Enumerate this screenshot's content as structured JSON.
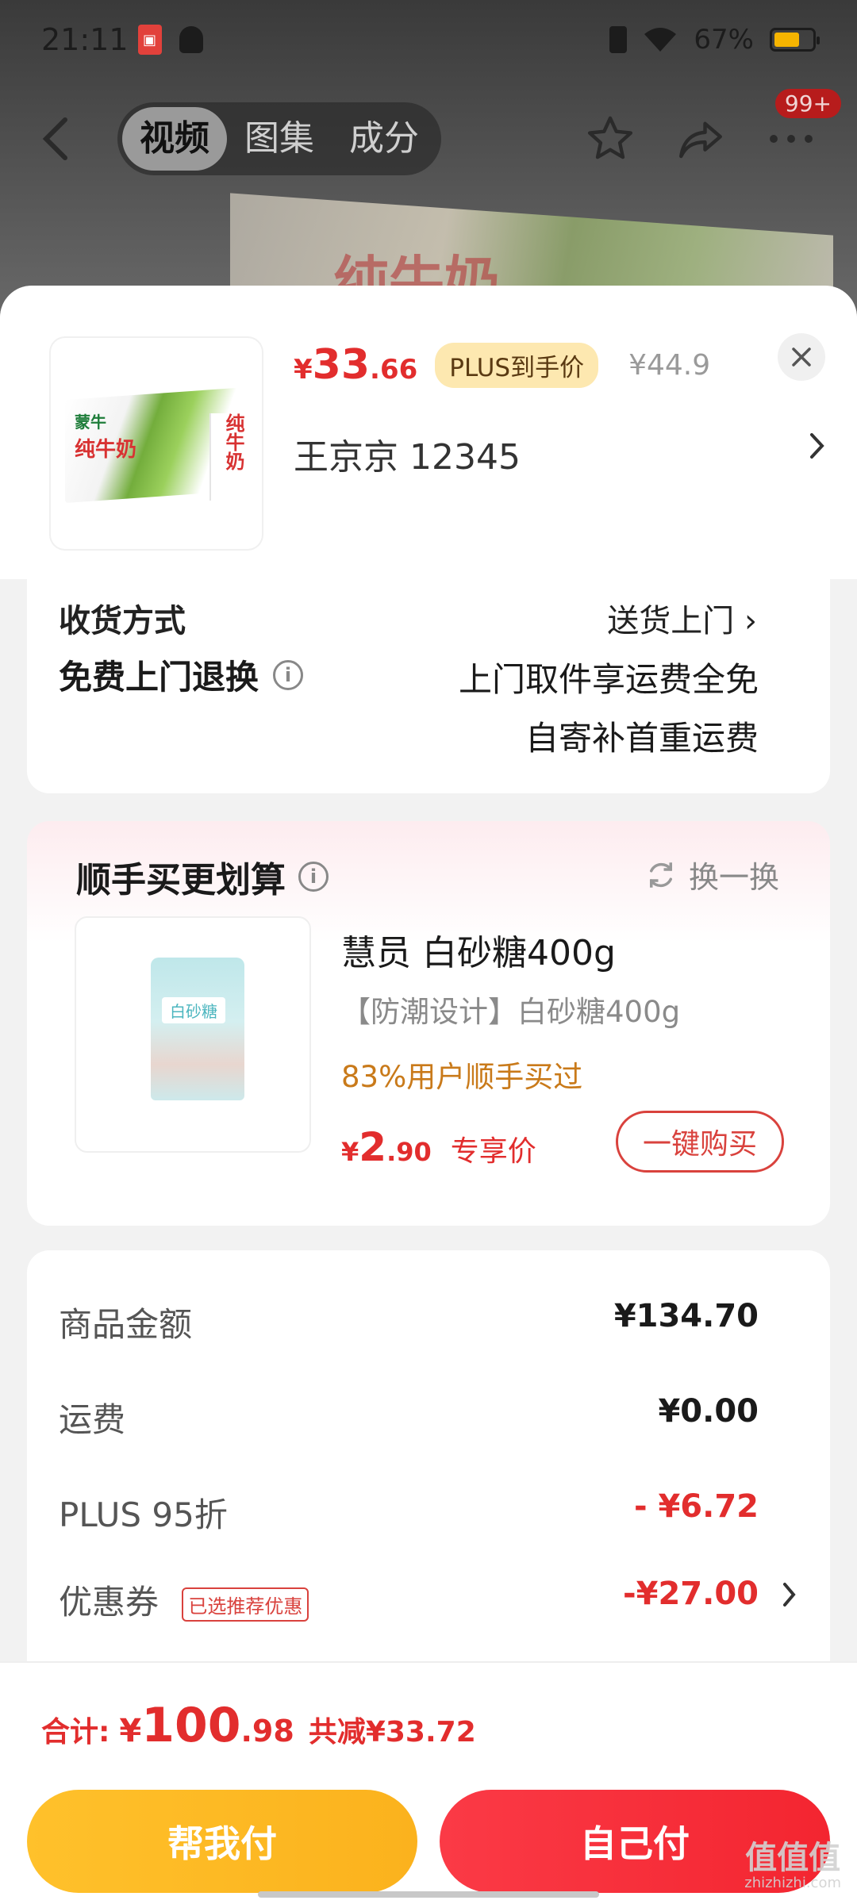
{
  "status_bar": {
    "time": "21:11",
    "battery": "67%"
  },
  "nav": {
    "tabs": [
      {
        "label": "视频",
        "active": true
      },
      {
        "label": "图集",
        "active": false
      },
      {
        "label": "成分",
        "active": false
      }
    ],
    "badge": "99+"
  },
  "background": {
    "product_text": "纯牛奶"
  },
  "product": {
    "brand": "蒙牛",
    "name": "纯牛奶",
    "price": {
      "symbol": "¥",
      "integer": "33",
      "decimal": ".66"
    },
    "plus_tag": "PLUS到手价",
    "original_price": "¥44.9",
    "address": "王京京  12345"
  },
  "service": {
    "cut_label": "收货方式",
    "cut_value": "送货上门 ›",
    "return_label": "免费上门退换",
    "return_value_line1": "上门取件享运费全免",
    "return_value_line2": "自寄补首重运费"
  },
  "upsell": {
    "title": "顺手买更划算",
    "swap_label": "换一换",
    "bag_label": "白砂糖",
    "name": "慧员 白砂糖400g",
    "desc": "【防潮设计】白砂糖400g",
    "stat": "83%用户顺手买过",
    "price": {
      "symbol": "¥",
      "integer": "2",
      "decimal": ".90"
    },
    "price_tag": "专享价",
    "buy_label": "一键购买"
  },
  "summary": {
    "rows": [
      {
        "label": "商品金额",
        "value": "¥134.70"
      },
      {
        "label": "运费",
        "value": "¥0.00"
      },
      {
        "label": "PLUS 95折",
        "value": "- ¥6.72"
      },
      {
        "label": "优惠券",
        "tag": "已选推荐优惠",
        "value": "-¥27.00"
      }
    ]
  },
  "footer": {
    "total_label": "合计:",
    "total": {
      "symbol": "¥",
      "integer": "100",
      "decimal": ".98"
    },
    "saved": "共减¥33.72",
    "help_pay": "帮我付",
    "self_pay": "自己付"
  },
  "watermark": {
    "main": "值值值",
    "sub": "zhizhizhi.com"
  },
  "colors": {
    "price_red": "#e22d2d",
    "gold": "#ffc12b",
    "orange_stat": "#c97a1a"
  }
}
